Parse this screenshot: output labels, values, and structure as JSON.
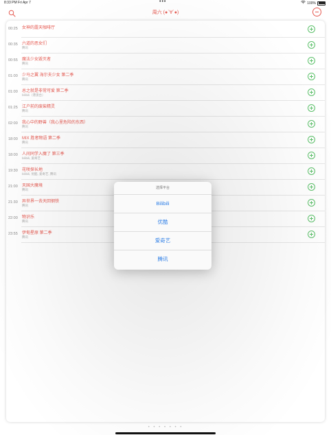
{
  "status_bar": {
    "time": "8:33 PM",
    "date": "Fri Apr 7",
    "dots": "•••",
    "battery": "100%"
  },
  "navbar": {
    "title": "周六 (●`∀´●)"
  },
  "schedule": [
    {
      "time": "00:25",
      "title": "女神的露天咖啡厅",
      "sub": ""
    },
    {
      "time": "00:35",
      "title": "六道的恶女们",
      "sub": "腾讯"
    },
    {
      "time": "00:55",
      "title": "魔法少女毁灭者",
      "sub": "腾讯"
    },
    {
      "time": "01:00",
      "title": "少马之翼 海尔夫少女 第二季",
      "sub": "腾讯"
    },
    {
      "time": "01:00",
      "title": "总之就是非常可爱 第二季",
      "sub": "bilibili（港澳台）"
    },
    {
      "time": "01:25",
      "title": "江户前的废柴精灵",
      "sub": "腾讯"
    },
    {
      "time": "02:00",
      "title": "我心中的野兽（我心里危险的东西）",
      "sub": "腾讯"
    },
    {
      "time": "18:00",
      "title": "MIX 胜者物语 第二季",
      "sub": "腾讯"
    },
    {
      "time": "18:00",
      "title": "人间同学入魔了 第三季",
      "sub": "bilibili, 爱奇艺"
    },
    {
      "time": "19:30",
      "title": "花咲探长地",
      "sub": "bilibili, 优酷, 爱奇艺, 腾讯"
    },
    {
      "time": "21:00",
      "title": "天国大魔境",
      "sub": "腾讯"
    },
    {
      "time": "21:30",
      "title": "异世界一去天回钢铁",
      "sub": "腾讯"
    },
    {
      "time": "22:00",
      "title": "物识乐",
      "sub": "腾讯"
    },
    {
      "time": "23:55",
      "title": "伊甸星原 第二季",
      "sub": "腾讯"
    }
  ],
  "popover": {
    "title": "选择平台",
    "options": [
      "Bilibili",
      "优酷",
      "爱奇艺",
      "腾讯"
    ]
  },
  "page_dots": "• • • • • • •",
  "colors": {
    "accent": "#e5584f",
    "add": "#5cc06a",
    "link": "#2f7fe6"
  }
}
